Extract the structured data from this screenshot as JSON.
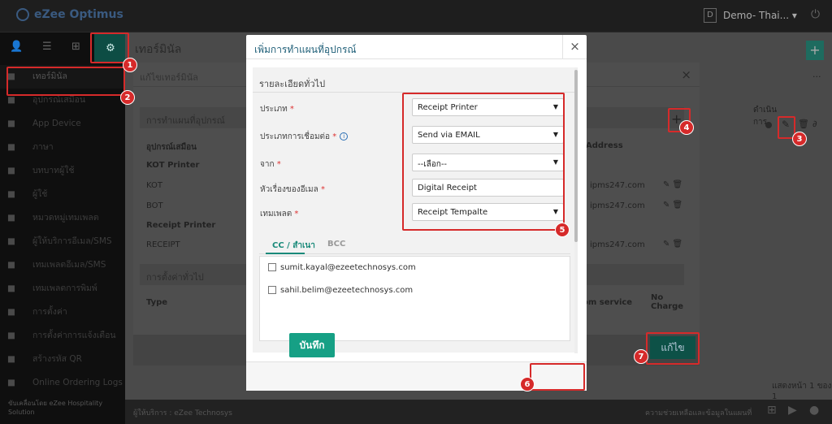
{
  "topbar": {
    "logo": "eZee Optimus",
    "property_code": "D",
    "property": "Demo- Thai..."
  },
  "sidebar": {
    "items": [
      {
        "label": "เทอร์มินัล",
        "icon": "terminal-icon"
      },
      {
        "label": "อุปกรณ์เสมือน",
        "icon": "device-icon"
      },
      {
        "label": "App Device",
        "icon": "mobile-icon"
      },
      {
        "label": "ภาษา",
        "icon": "language-icon"
      },
      {
        "label": "บทบาทผู้ใช้",
        "icon": "role-icon"
      },
      {
        "label": "ผู้ใช้",
        "icon": "user-icon"
      },
      {
        "label": "หมวดหมู่เทมเพลต",
        "icon": "category-icon"
      },
      {
        "label": "ผู้ให้บริการอีเมล/SMS",
        "icon": "mail-icon"
      },
      {
        "label": "เทมเพลตอีเมล/SMS",
        "icon": "template-icon"
      },
      {
        "label": "เทมเพลตการพิมพ์",
        "icon": "print-template-icon"
      },
      {
        "label": "การตั้งค่า",
        "icon": "settings-icon"
      },
      {
        "label": "การตั้งค่าการแจ้งเตือน",
        "icon": "bell-icon"
      },
      {
        "label": "สร้างรหัส QR",
        "icon": "qr-icon"
      },
      {
        "label": "Online Ordering Logs",
        "icon": "log-icon"
      }
    ],
    "footer": "ขับเคลื่อนโดย eZee Hospitality Solution"
  },
  "page": {
    "title": "เทอร์มินัล",
    "page_info": "แสดงหน้า 1 ของ 1",
    "footer_text": "ผู้ให้บริการ : eZee Technosys",
    "footer_right": "ความช่วยเหลือและข้อมูลในแผนที่"
  },
  "edit_modal": {
    "title": "แก้ไขเทอร์มินัล",
    "section1": "การทำแผนที่อุปกรณ์",
    "col_device": "อุปกรณ์เสมือน",
    "col_address": "Address",
    "col_action": "ดำเนินการ",
    "kot_group": "KOT Printer",
    "rows": [
      "KOT",
      "BOT"
    ],
    "receipt_group": "Receipt Printer",
    "receipt_row": "RECEIPT",
    "address": "ipms247.com",
    "section2": "การตั้งค่าทั่วไป",
    "col_type": "Type",
    "col_room": "om service",
    "col_nocharge": "No Charge",
    "edit_button": "แก้ไข"
  },
  "dialog": {
    "title": "เพิ่มการทำแผนที่อุปกรณ์",
    "section": "รายละเอียดทั่วไป",
    "fields": {
      "type_label": "ประเภท",
      "type_value": "Receipt Printer",
      "conn_label": "ประเภทการเชื่อมต่อ",
      "conn_value": "Send via EMAIL",
      "from_label": "จาก",
      "from_value": "--เลือก--",
      "subject_label": "หัวเรื่องของอีเมล",
      "subject_value": "Digital Receipt",
      "template_label": "เทมเพลต",
      "template_value": "Receipt Tempalte"
    },
    "tabs": {
      "cc": "CC / สำเนา",
      "bcc": "BCC"
    },
    "emails": [
      "sumit.kayal@ezeetechnosys.com",
      "sahil.belim@ezeetechnosys.com"
    ],
    "save_button": "บันทึก"
  },
  "markers": [
    "1",
    "2",
    "3",
    "4",
    "5",
    "6",
    "7"
  ],
  "colors": {
    "accent": "#16a085",
    "highlight": "#d62a2a",
    "title": "#1f5f78"
  }
}
